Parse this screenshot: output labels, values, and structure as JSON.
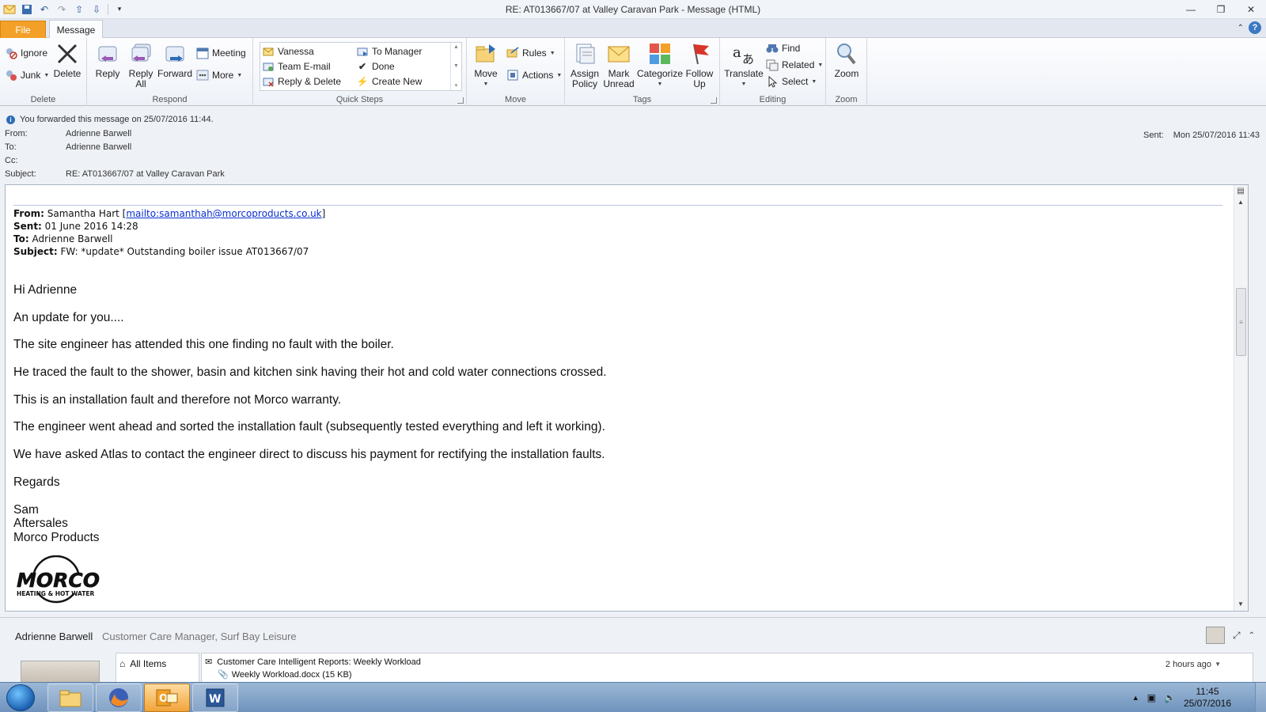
{
  "window": {
    "title": "RE: AT013667/07 at Valley Caravan Park  - Message (HTML)"
  },
  "tabs": {
    "file": "File",
    "message": "Message"
  },
  "ribbon": {
    "delete_group": {
      "label": "Delete",
      "ignore": "Ignore",
      "junk": "Junk",
      "delete": "Delete"
    },
    "respond_group": {
      "label": "Respond",
      "reply": "Reply",
      "reply_all_1": "Reply",
      "reply_all_2": "All",
      "forward": "Forward",
      "meeting": "Meeting",
      "more": "More"
    },
    "quicksteps_group": {
      "label": "Quick Steps",
      "items": [
        "Vanessa",
        "To Manager",
        "Team E-mail",
        "Done",
        "Reply & Delete",
        "Create New"
      ]
    },
    "move_group": {
      "label": "Move",
      "move": "Move",
      "rules": "Rules",
      "actions": "Actions"
    },
    "tags_group": {
      "label": "Tags",
      "assign_1": "Assign",
      "assign_2": "Policy",
      "mark_1": "Mark",
      "mark_2": "Unread",
      "categorize": "Categorize",
      "follow_1": "Follow",
      "follow_2": "Up"
    },
    "editing_group": {
      "label": "Editing",
      "translate": "Translate",
      "find": "Find",
      "related": "Related",
      "select": "Select"
    },
    "zoom_group": {
      "label": "Zoom",
      "zoom": "Zoom"
    }
  },
  "header": {
    "info": "You forwarded this message on 25/07/2016 11:44.",
    "from_label": "From:",
    "from": "Adrienne Barwell",
    "to_label": "To:",
    "to": "Adrienne Barwell",
    "cc_label": "Cc:",
    "cc": "",
    "subject_label": "Subject:",
    "subject": "RE: AT013667/07 at Valley Caravan Park",
    "sent_label": "Sent:",
    "sent": "Mon 25/07/2016 11:43"
  },
  "forwarded": {
    "from_label": "From:",
    "from_name": " Samantha Hart [",
    "from_link": "mailto:samanthah@morcoproducts.co.uk",
    "from_end": "]",
    "sent_label": "Sent:",
    "sent": " 01 June 2016 14:28",
    "to_label": "To:",
    "to": " Adrienne Barwell",
    "subject_label": "Subject:",
    "subject": " FW: *update* Outstanding boiler issue AT013667/07"
  },
  "body": {
    "paragraphs": [
      "Hi Adrienne",
      "An update for you....",
      "The site engineer has attended this one finding no fault with the boiler.",
      "He traced the fault to the shower, basin and kitchen sink having their hot and cold water connections crossed.",
      "This is an installation fault and therefore not Morco warranty.",
      "The engineer went ahead and sorted the installation fault (subsequently tested everything and left it working).",
      "We have asked Atlas to contact the engineer direct to discuss his payment for rectifying the installation faults.",
      "Regards"
    ],
    "signature": [
      "Sam",
      "Aftersales",
      "Morco Products"
    ],
    "logo_text": "MORCO",
    "logo_subtext": "HEATING & HOT WATER"
  },
  "people_pane": {
    "name": "Adrienne Barwell",
    "title": "Customer Care Manager, Surf Bay Leisure",
    "all_items": "All Items",
    "feed_title": "Customer Care Intelligent Reports: Weekly Workload",
    "feed_attachment": "Weekly Workload.docx (15 KB)",
    "feed_time": "2 hours ago"
  },
  "taskbar": {
    "time": "11:45",
    "date": "25/07/2016"
  },
  "colors": {
    "file_tab": "#f2a028",
    "link": "#0a2fd0",
    "taskbar": "#7f9fc6"
  }
}
